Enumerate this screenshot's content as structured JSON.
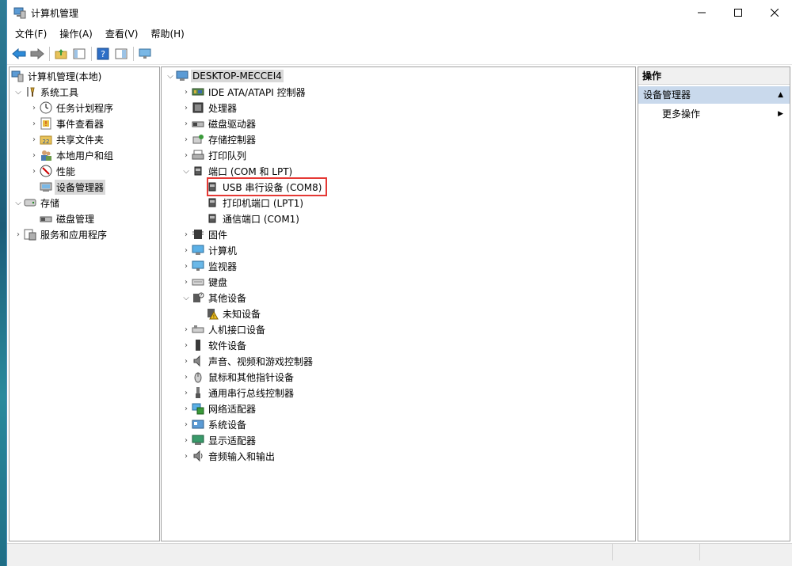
{
  "window": {
    "title": "计算机管理",
    "minimize": "—",
    "maximize": "☐",
    "close": "✕"
  },
  "menu": [
    "文件(F)",
    "操作(A)",
    "查看(V)",
    "帮助(H)"
  ],
  "toolbar_icons": [
    "back-arrow-icon",
    "forward-arrow-icon",
    "up-folder-icon",
    "show-hide-tree-icon",
    "help-icon",
    "properties-icon",
    "monitor-icon"
  ],
  "left_tree": [
    {
      "label": "计算机管理(本地)",
      "icon": "computer-mgmt-icon"
    },
    {
      "label": "系统工具",
      "icon": "tools-icon"
    },
    {
      "label": "任务计划程序",
      "icon": "clock-icon"
    },
    {
      "label": "事件查看器",
      "icon": "event-viewer-icon"
    },
    {
      "label": "共享文件夹",
      "icon": "shared-folder-icon"
    },
    {
      "label": "本地用户和组",
      "icon": "users-icon"
    },
    {
      "label": "性能",
      "icon": "performance-icon"
    },
    {
      "label": "设备管理器",
      "icon": "device-manager-icon",
      "selected": true
    },
    {
      "label": "存储",
      "icon": "storage-icon"
    },
    {
      "label": "磁盘管理",
      "icon": "disk-icon"
    },
    {
      "label": "服务和应用程序",
      "icon": "services-icon"
    }
  ],
  "device_tree": {
    "root": "DESKTOP-MECCEI4",
    "items": [
      {
        "label": "IDE ATA/ATAPI 控制器",
        "icon": "ide-controller-icon"
      },
      {
        "label": "处理器",
        "icon": "processor-icon"
      },
      {
        "label": "磁盘驱动器",
        "icon": "disk-drive-icon"
      },
      {
        "label": "存储控制器",
        "icon": "storage-controller-icon"
      },
      {
        "label": "打印队列",
        "icon": "printer-icon"
      },
      {
        "label": "端口 (COM 和 LPT)",
        "icon": "port-icon"
      },
      {
        "label": "USB 串行设备 (COM8)",
        "icon": "port-icon",
        "highlighted": true
      },
      {
        "label": "打印机端口 (LPT1)",
        "icon": "port-icon"
      },
      {
        "label": "通信端口 (COM1)",
        "icon": "port-icon"
      },
      {
        "label": "固件",
        "icon": "firmware-icon"
      },
      {
        "label": "计算机",
        "icon": "computer-icon"
      },
      {
        "label": "监视器",
        "icon": "monitor-icon"
      },
      {
        "label": "键盘",
        "icon": "keyboard-icon"
      },
      {
        "label": "其他设备",
        "icon": "other-devices-icon"
      },
      {
        "label": "未知设备",
        "icon": "unknown-device-warning-icon"
      },
      {
        "label": "人机接口设备",
        "icon": "hid-icon"
      },
      {
        "label": "软件设备",
        "icon": "software-device-icon"
      },
      {
        "label": "声音、视频和游戏控制器",
        "icon": "sound-icon"
      },
      {
        "label": "鼠标和其他指针设备",
        "icon": "mouse-icon"
      },
      {
        "label": "通用串行总线控制器",
        "icon": "usb-icon"
      },
      {
        "label": "网络适配器",
        "icon": "network-adapter-icon"
      },
      {
        "label": "系统设备",
        "icon": "system-device-icon"
      },
      {
        "label": "显示适配器",
        "icon": "display-adapter-icon"
      },
      {
        "label": "音频输入和输出",
        "icon": "audio-io-icon"
      }
    ]
  },
  "actions": {
    "header": "操作",
    "section": "设备管理器",
    "more": "更多操作"
  },
  "colors": {
    "selection": "#d9d9d9",
    "highlight_box": "#e53935",
    "actions_section_bg": "#c9d9ec"
  }
}
